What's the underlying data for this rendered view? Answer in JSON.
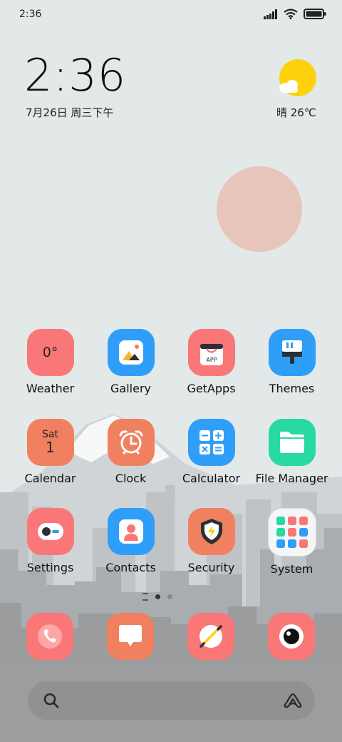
{
  "status_bar": {
    "time": "2:36"
  },
  "clock_widget": {
    "time": "2:36",
    "date": "7月26日 周三下午"
  },
  "weather_widget": {
    "condition_temp": "晴 26℃"
  },
  "apps": [
    {
      "label": "Weather",
      "icon": "weather-icon",
      "color": "#fa7777",
      "icon_text": "0°"
    },
    {
      "label": "Gallery",
      "icon": "gallery-icon",
      "color": "#2f9ef8"
    },
    {
      "label": "GetApps",
      "icon": "getapps-icon",
      "color": "#fa7777",
      "icon_text": "APP"
    },
    {
      "label": "Themes",
      "icon": "themes-icon",
      "color": "#2f9ef8"
    },
    {
      "label": "Calendar",
      "icon": "calendar-icon",
      "color": "#f0805f",
      "icon_text": "Sat",
      "icon_text2": "1"
    },
    {
      "label": "Clock",
      "icon": "clock-icon",
      "color": "#f0805f"
    },
    {
      "label": "Calculator",
      "icon": "calculator-icon",
      "color": "#2f9ef8"
    },
    {
      "label": "File Manager",
      "icon": "folder-icon",
      "color": "#28d9a2"
    },
    {
      "label": "Settings",
      "icon": "settings-icon",
      "color": "#fa7777"
    },
    {
      "label": "Contacts",
      "icon": "contacts-icon",
      "color": "#2f9ef8"
    },
    {
      "label": "Security",
      "icon": "security-icon",
      "color": "#f0805f"
    },
    {
      "label": "System",
      "icon": "system-folder-icon",
      "color": "#f4f6f7"
    }
  ],
  "page_indicator": {
    "pages": 2,
    "current": 1
  },
  "dock": [
    {
      "icon": "phone-icon",
      "color": "#fa7777"
    },
    {
      "icon": "messaging-icon",
      "color": "#f0805f"
    },
    {
      "icon": "browser-icon",
      "color": "#fa7777"
    },
    {
      "icon": "camera-icon",
      "color": "#fa7777"
    }
  ],
  "search_bar": {
    "icon": "search-icon",
    "assistant_icon": "assistant-icon"
  }
}
